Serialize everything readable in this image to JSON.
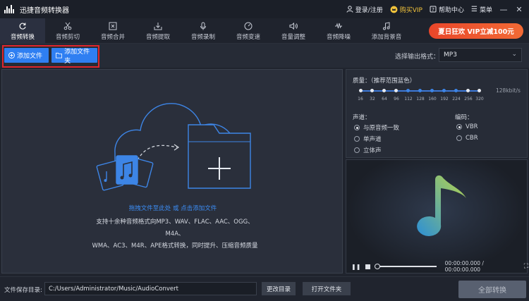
{
  "app": {
    "title": "迅捷音频转换器"
  },
  "titlebar": {
    "login": "登录/注册",
    "buy_vip": "购买VIP",
    "help": "帮助中心",
    "menu": "菜单",
    "minimize": "—",
    "close": "✕"
  },
  "tabs": [
    {
      "label": "音频转换",
      "icon": "refresh-icon"
    },
    {
      "label": "音频剪切",
      "icon": "scissors-icon"
    },
    {
      "label": "音频合并",
      "icon": "merge-icon"
    },
    {
      "label": "音频提取",
      "icon": "extract-icon"
    },
    {
      "label": "音频录制",
      "icon": "microphone-icon"
    },
    {
      "label": "音频变速",
      "icon": "speed-icon"
    },
    {
      "label": "音量调整",
      "icon": "volume-icon"
    },
    {
      "label": "音频降噪",
      "icon": "denoise-icon"
    },
    {
      "label": "添加背景音",
      "icon": "background-music-icon"
    }
  ],
  "promo": {
    "label": "夏日狂欢 VIP立减100元"
  },
  "actions": {
    "add_file": "添加文件",
    "add_folder": "添加文件夹",
    "output_format_label": "选择输出格式：",
    "output_format_value": "MP3"
  },
  "dropzone": {
    "hint": "拖拽文件至此处 或 点击添加文件",
    "desc_line1": "支持十余种音频格式向MP3、WAV、FLAC、AAC、OGG、M4A、",
    "desc_line2": "WMA、AC3、M4R、APE格式转换，同时提升、压缩音频质量"
  },
  "settings": {
    "quality_label": "质量：（推荐范围蓝色）",
    "quality_ticks": [
      "16",
      "32",
      "64",
      "96",
      "112",
      "128",
      "160",
      "192",
      "224",
      "256",
      "320"
    ],
    "quality_selected": "128",
    "quality_value": "128kbit/s",
    "channel_label": "声道：",
    "channel_options": [
      "与原音频一致",
      "单声道",
      "立体声"
    ],
    "channel_selected": "与原音频一致",
    "encoding_label": "编码：",
    "encoding_options": [
      "VBR",
      "CBR"
    ],
    "encoding_selected": "VBR"
  },
  "player": {
    "time": "00:00:00.000 / 00:00:00.000"
  },
  "bottom": {
    "save_dir_label": "文件保存目录:",
    "save_dir_value": "C:/Users/Administrator/Music/AudioConvert",
    "change_dir": "更改目录",
    "open_folder": "打开文件夹",
    "convert_all": "全部转换"
  },
  "colors": {
    "accent": "#2f7ff2",
    "promo": "#ef5530",
    "vip_gold": "#f2c33b",
    "highlight_box": "#e0262c"
  }
}
